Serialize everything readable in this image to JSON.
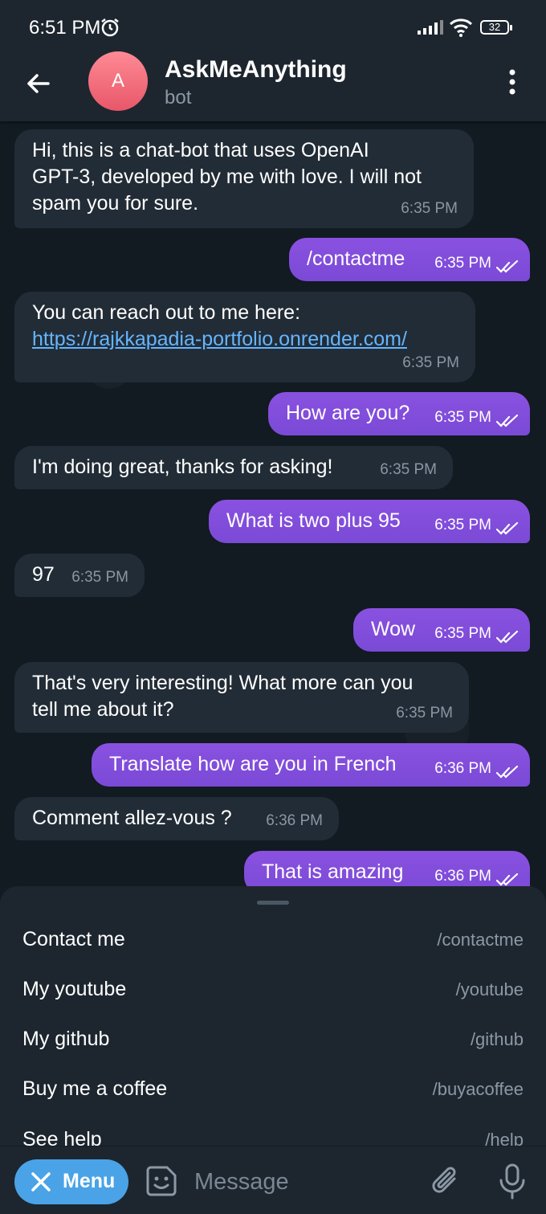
{
  "status_bar": {
    "time": "6:51 PM",
    "battery": "32"
  },
  "header": {
    "avatar_letter": "A",
    "title": "AskMeAnything",
    "subtitle": "bot"
  },
  "messages": [
    {
      "dir": "in",
      "text": "Hi, this is a chat-bot that uses OpenAI\nGPT-3, developed by me with love. I will not\nspam you for sure.",
      "time": "6:35 PM"
    },
    {
      "dir": "out",
      "text": "/contactme",
      "time": "6:35 PM"
    },
    {
      "dir": "in",
      "text": "You can reach out to me here:",
      "link": "https://rajkkapadia-portfolio.onrender.com/",
      "time": "6:35 PM"
    },
    {
      "dir": "out",
      "text": "How are you?",
      "time": "6:35 PM"
    },
    {
      "dir": "in",
      "text": "I'm doing great, thanks for asking!",
      "time": "6:35 PM"
    },
    {
      "dir": "out",
      "text": "What is two plus 95",
      "time": "6:35 PM"
    },
    {
      "dir": "in",
      "text": "97",
      "time": "6:35 PM"
    },
    {
      "dir": "out",
      "text": "Wow",
      "time": "6:35 PM"
    },
    {
      "dir": "in",
      "text": "That's very interesting! What more can you\ntell me about it?",
      "time": "6:35 PM"
    },
    {
      "dir": "out",
      "text": "Translate how are you in French",
      "time": "6:36 PM"
    },
    {
      "dir": "in",
      "text": "Comment allez-vous ?",
      "time": "6:36 PM"
    },
    {
      "dir": "out",
      "text": "That is amazing",
      "time": "6:36 PM"
    }
  ],
  "bot_menu": {
    "commands": [
      {
        "label": "Contact me",
        "command": "/contactme"
      },
      {
        "label": "My youtube",
        "command": "/youtube"
      },
      {
        "label": "My github",
        "command": "/github"
      },
      {
        "label": "Buy me a coffee",
        "command": "/buyacoffee"
      },
      {
        "label": "See help",
        "command": "/help"
      }
    ]
  },
  "input_bar": {
    "menu_label": "Menu",
    "placeholder": "Message"
  },
  "colors": {
    "outgoing": "#7e4cd6",
    "incoming": "#222c36",
    "accent": "#4aa3e6",
    "link": "#64b5ff"
  }
}
